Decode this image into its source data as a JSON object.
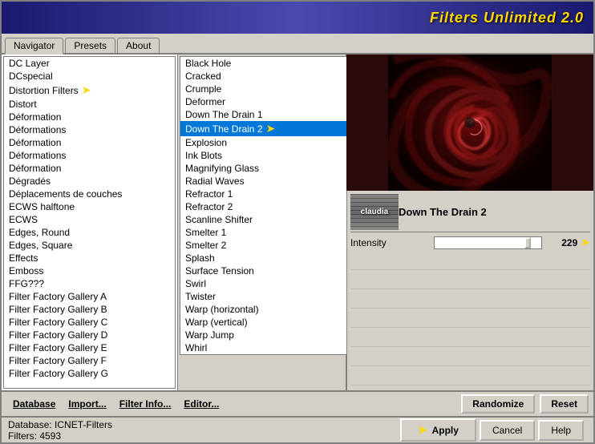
{
  "app": {
    "title": "Filters Unlimited 2.0"
  },
  "tabs": [
    {
      "id": "navigator",
      "label": "Navigator",
      "active": true
    },
    {
      "id": "presets",
      "label": "Presets",
      "active": false
    },
    {
      "id": "about",
      "label": "About",
      "active": false
    }
  ],
  "filter_categories": [
    {
      "id": 1,
      "label": "DC Layer",
      "arrow": false
    },
    {
      "id": 2,
      "label": "DCspecial",
      "arrow": false
    },
    {
      "id": 3,
      "label": "Distortion Filters",
      "arrow": true
    },
    {
      "id": 4,
      "label": "Distort",
      "arrow": false
    },
    {
      "id": 5,
      "label": "Déformation",
      "arrow": false
    },
    {
      "id": 6,
      "label": "Déformations",
      "arrow": false
    },
    {
      "id": 7,
      "label": "Déformation",
      "arrow": false
    },
    {
      "id": 8,
      "label": "Déformations",
      "arrow": false
    },
    {
      "id": 9,
      "label": "Déformation",
      "arrow": false
    },
    {
      "id": 10,
      "label": "Dégradés",
      "arrow": false
    },
    {
      "id": 11,
      "label": "Déplacements de couches",
      "arrow": false
    },
    {
      "id": 12,
      "label": "ECWS halftone",
      "arrow": false
    },
    {
      "id": 13,
      "label": "ECWS",
      "arrow": false
    },
    {
      "id": 14,
      "label": "Edges, Round",
      "arrow": false
    },
    {
      "id": 15,
      "label": "Edges, Square",
      "arrow": false
    },
    {
      "id": 16,
      "label": "Effects",
      "arrow": false
    },
    {
      "id": 17,
      "label": "Emboss",
      "arrow": false
    },
    {
      "id": 18,
      "label": "FFG???",
      "arrow": false
    },
    {
      "id": 19,
      "label": "Filter Factory Gallery A",
      "arrow": false
    },
    {
      "id": 20,
      "label": "Filter Factory Gallery B",
      "arrow": false
    },
    {
      "id": 21,
      "label": "Filter Factory Gallery C",
      "arrow": false
    },
    {
      "id": 22,
      "label": "Filter Factory Gallery D",
      "arrow": false
    },
    {
      "id": 23,
      "label": "Filter Factory Gallery E",
      "arrow": false
    },
    {
      "id": 24,
      "label": "Filter Factory Gallery F",
      "arrow": false
    },
    {
      "id": 25,
      "label": "Filter Factory Gallery G",
      "arrow": false
    }
  ],
  "filter_effects": [
    {
      "id": 1,
      "label": "Black Hole",
      "selected": false
    },
    {
      "id": 2,
      "label": "Cracked",
      "selected": false
    },
    {
      "id": 3,
      "label": "Crumple",
      "selected": false
    },
    {
      "id": 4,
      "label": "Deformer",
      "selected": false
    },
    {
      "id": 5,
      "label": "Down The Drain 1",
      "selected": false
    },
    {
      "id": 6,
      "label": "Down The Drain 2",
      "selected": true,
      "arrow": true
    },
    {
      "id": 7,
      "label": "Explosion",
      "selected": false
    },
    {
      "id": 8,
      "label": "Ink Blots",
      "selected": false
    },
    {
      "id": 9,
      "label": "Magnifying Glass",
      "selected": false
    },
    {
      "id": 10,
      "label": "Radial Waves",
      "selected": false
    },
    {
      "id": 11,
      "label": "Refractor 1",
      "selected": false
    },
    {
      "id": 12,
      "label": "Refractor 2",
      "selected": false
    },
    {
      "id": 13,
      "label": "Scanline Shifter",
      "selected": false
    },
    {
      "id": 14,
      "label": "Smelter 1",
      "selected": false
    },
    {
      "id": 15,
      "label": "Smelter 2",
      "selected": false
    },
    {
      "id": 16,
      "label": "Splash",
      "selected": false
    },
    {
      "id": 17,
      "label": "Surface Tension",
      "selected": false
    },
    {
      "id": 18,
      "label": "Swirl",
      "selected": false
    },
    {
      "id": 19,
      "label": "Twister",
      "selected": false
    },
    {
      "id": 20,
      "label": "Warp (horizontal)",
      "selected": false
    },
    {
      "id": 21,
      "label": "Warp (vertical)",
      "selected": false
    },
    {
      "id": 22,
      "label": "Warp Jump",
      "selected": false
    },
    {
      "id": 23,
      "label": "Whirl",
      "selected": false
    }
  ],
  "selected_filter": {
    "name": "Down The Drain 2",
    "thumbnail_label": "claudia",
    "parameters": [
      {
        "id": "intensity",
        "label": "Intensity",
        "value": 229,
        "min": 0,
        "max": 255,
        "arrow": true
      },
      {
        "id": "param2",
        "label": "",
        "value": null
      },
      {
        "id": "param3",
        "label": "",
        "value": null
      },
      {
        "id": "param4",
        "label": "",
        "value": null
      },
      {
        "id": "param5",
        "label": "",
        "value": null
      },
      {
        "id": "param6",
        "label": "",
        "value": null
      },
      {
        "id": "param7",
        "label": "",
        "value": null
      },
      {
        "id": "param8",
        "label": "",
        "value": null
      }
    ]
  },
  "toolbar": {
    "database_label": "Database",
    "import_label": "Import...",
    "filter_info_label": "Filter Info...",
    "editor_label": "Editor...",
    "randomize_label": "Randomize",
    "reset_label": "Reset"
  },
  "statusbar": {
    "database_label": "Database:",
    "database_value": "ICNET-Filters",
    "filters_label": "Filters:",
    "filters_value": "4593"
  },
  "actions": {
    "apply_label": "Apply",
    "cancel_label": "Cancel",
    "help_label": "Help"
  },
  "icons": {
    "arrow_right": "➤",
    "gold_arrow": "➤"
  }
}
